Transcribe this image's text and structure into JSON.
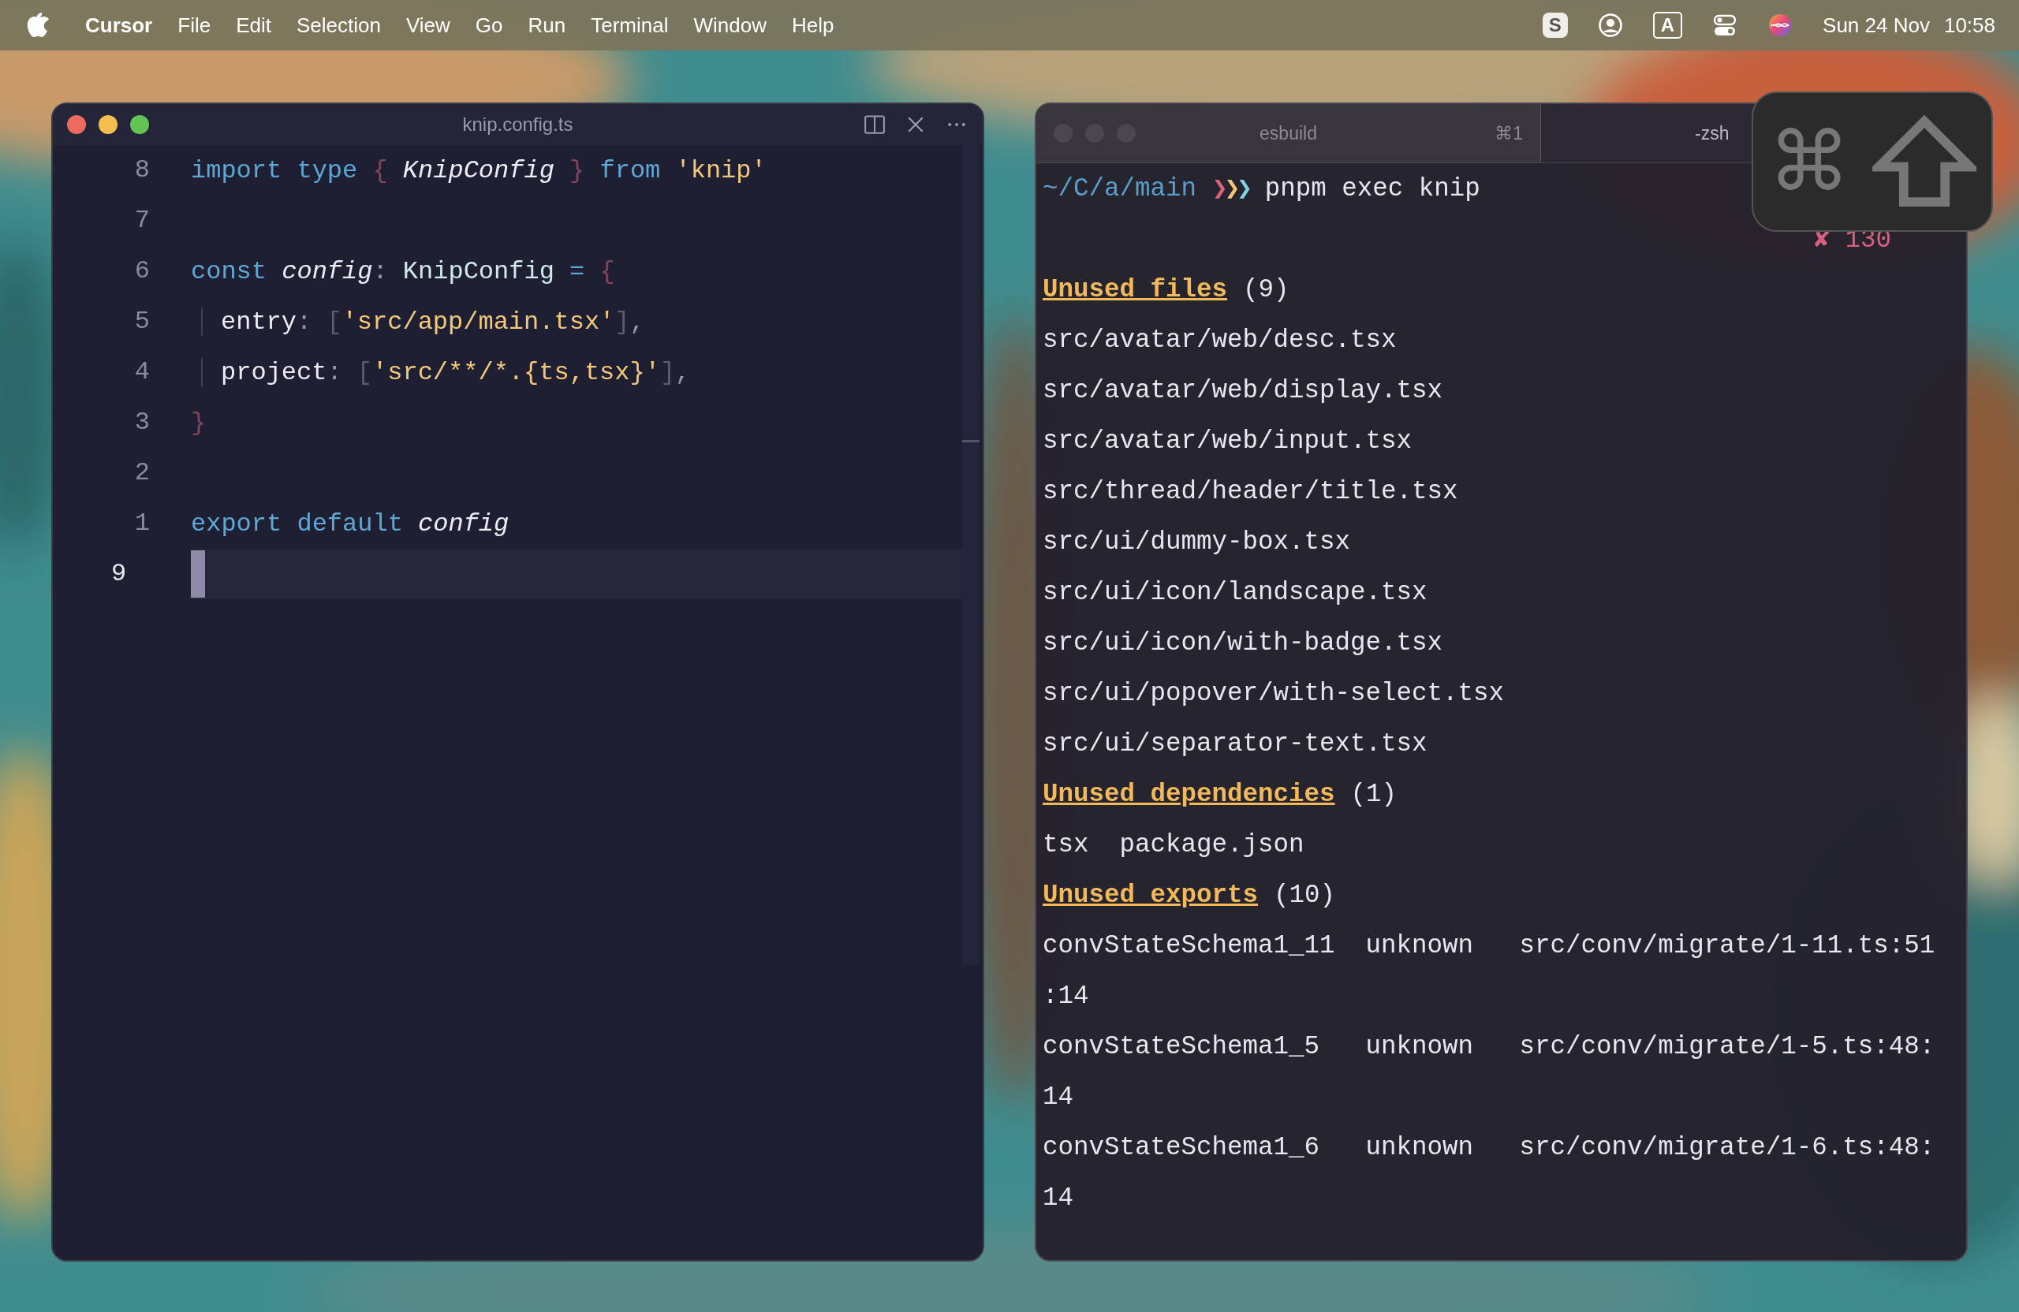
{
  "menubar": {
    "menus": [
      {
        "label": "Cursor",
        "kind": "app"
      },
      {
        "label": "File",
        "kind": "menu"
      },
      {
        "label": "Edit",
        "kind": "menu"
      },
      {
        "label": "Selection",
        "kind": "menu"
      },
      {
        "label": "View",
        "kind": "menu"
      },
      {
        "label": "Go",
        "kind": "menu"
      },
      {
        "label": "Run",
        "kind": "menu"
      },
      {
        "label": "Terminal",
        "kind": "menu"
      },
      {
        "label": "Window",
        "kind": "menu"
      },
      {
        "label": "Help",
        "kind": "menu"
      }
    ],
    "status_items": [
      {
        "kind": "app",
        "label": "S"
      },
      {
        "kind": "user"
      },
      {
        "kind": "input",
        "label": "A"
      },
      {
        "kind": "toggles"
      },
      {
        "kind": "siri"
      }
    ],
    "date": "Sun 24 Nov",
    "time": "10:58"
  },
  "editor": {
    "title": "knip.config.ts",
    "lines": [
      {
        "number": "8",
        "current": false,
        "tokens": [
          {
            "text": "import type ",
            "kind": "keyword"
          },
          {
            "text": "{ ",
            "kind": "brace"
          },
          {
            "text": "KnipConfig ",
            "kind": "italic"
          },
          {
            "text": "} ",
            "kind": "brace"
          },
          {
            "text": "from ",
            "kind": "keyword"
          },
          {
            "text": "'knip'",
            "kind": "string"
          }
        ]
      },
      {
        "number": "7",
        "current": false
      },
      {
        "number": "6",
        "current": false,
        "tokens": [
          {
            "text": "const ",
            "kind": "keyword"
          },
          {
            "text": "config",
            "kind": "italic"
          },
          {
            "text": ": ",
            "kind": "punct"
          },
          {
            "text": "KnipConfig ",
            "kind": "type"
          },
          {
            "text": "= ",
            "kind": "keyword"
          },
          {
            "text": "{",
            "kind": "brace"
          }
        ]
      },
      {
        "number": "5",
        "current": false,
        "indent": true,
        "tokens": [
          {
            "text": "entry",
            "kind": "plain"
          },
          {
            "text": ": ",
            "kind": "punct"
          },
          {
            "text": "[",
            "kind": "bracket"
          },
          {
            "text": "'src/app/main.tsx'",
            "kind": "string"
          },
          {
            "text": "]",
            "kind": "bracket"
          },
          {
            "text": ",",
            "kind": "punct"
          }
        ]
      },
      {
        "number": "4",
        "current": false,
        "indent": true,
        "tokens": [
          {
            "text": "project",
            "kind": "plain"
          },
          {
            "text": ": ",
            "kind": "punct"
          },
          {
            "text": "[",
            "kind": "bracket"
          },
          {
            "text": "'src/**/*.{ts,tsx}'",
            "kind": "string"
          },
          {
            "text": "]",
            "kind": "bracket"
          },
          {
            "text": ",",
            "kind": "punct"
          }
        ]
      },
      {
        "number": "3",
        "current": false,
        "tokens": [
          {
            "text": "}",
            "kind": "brace"
          }
        ]
      },
      {
        "number": "2",
        "current": false
      },
      {
        "number": "1",
        "current": false,
        "tokens": [
          {
            "text": "export default ",
            "kind": "keyword"
          },
          {
            "text": "config",
            "kind": "italic"
          }
        ]
      },
      {
        "number": "9",
        "current": true
      }
    ]
  },
  "terminal": {
    "tabs": [
      {
        "label": "esbuild",
        "shortcut": "⌘1",
        "selected": false
      },
      {
        "label": "-zsh",
        "selected": true
      }
    ],
    "prompt": {
      "path": "~/C/a/main",
      "chevrons": [
        {
          "text": "❯",
          "color": "#e0607e"
        },
        {
          "text": "❯",
          "color": "#f2c87a"
        },
        {
          "text": "❯",
          "color": "#7fd3e0"
        }
      ],
      "command": "pnpm exec knip"
    },
    "exit_status": "✘ 130",
    "lines": [
      {
        "kind": "heading",
        "title": "Unused files",
        "count": "(9)"
      },
      {
        "kind": "text",
        "text": "src/avatar/web/desc.tsx"
      },
      {
        "kind": "text",
        "text": "src/avatar/web/display.tsx"
      },
      {
        "kind": "text",
        "text": "src/avatar/web/input.tsx"
      },
      {
        "kind": "text",
        "text": "src/thread/header/title.tsx"
      },
      {
        "kind": "text",
        "text": "src/ui/dummy-box.tsx"
      },
      {
        "kind": "text",
        "text": "src/ui/icon/landscape.tsx"
      },
      {
        "kind": "text",
        "text": "src/ui/icon/with-badge.tsx"
      },
      {
        "kind": "text",
        "text": "src/ui/popover/with-select.tsx"
      },
      {
        "kind": "text",
        "text": "src/ui/separator-text.tsx"
      },
      {
        "kind": "heading",
        "title": "Unused dependencies",
        "count": "(1)"
      },
      {
        "kind": "text",
        "text": "tsx  package.json"
      },
      {
        "kind": "heading",
        "title": "Unused exports",
        "count": "(10)"
      },
      {
        "kind": "text",
        "text": "convStateSchema1_11  unknown   src/conv/migrate/1-11.ts:51"
      },
      {
        "kind": "text",
        "text": ":14"
      },
      {
        "kind": "text",
        "text": "convStateSchema1_5   unknown   src/conv/migrate/1-5.ts:48:"
      },
      {
        "kind": "text",
        "text": "14"
      },
      {
        "kind": "text",
        "text": "convStateSchema1_6   unknown   src/conv/migrate/1-6.ts:48:"
      },
      {
        "kind": "text",
        "text": "14"
      }
    ]
  },
  "key_overlay": {
    "keys": [
      {
        "kind": "command",
        "label": "⌘"
      },
      {
        "kind": "shift"
      }
    ]
  }
}
